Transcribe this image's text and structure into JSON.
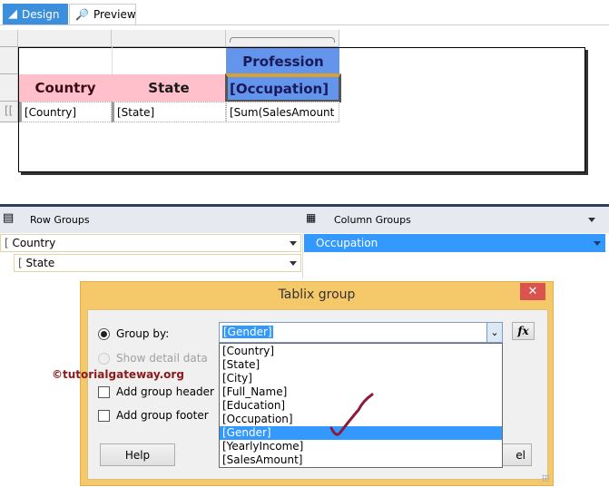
{
  "tabs": [
    {
      "label": "Design",
      "icon": "design-ruler-icon",
      "active": true
    },
    {
      "label": "Preview",
      "icon": "preview-icon",
      "active": false
    }
  ],
  "tablix": {
    "header_row1": {
      "profession": "Profession"
    },
    "header_row2": {
      "country": "Country",
      "state": "State",
      "occupation": "[Occupation]"
    },
    "data_row": {
      "country": "[Country]",
      "state": "[State]",
      "sum": "[Sum(SalesAmount"
    }
  },
  "groups": {
    "row_groups_label": "Row Groups",
    "column_groups_label": "Column Groups",
    "row_groups": [
      "Country",
      "State"
    ],
    "column_groups": [
      "Occupation"
    ]
  },
  "dialog": {
    "title": "Tablix group",
    "group_by_label": "Group by:",
    "group_by_value": "[Gender]",
    "show_detail_label": "Show detail data",
    "add_header_label": "Add group header",
    "add_footer_label": "Add group footer",
    "fx_label": "fx",
    "help_label": "Help",
    "cancel_partial": "el",
    "options": [
      "[Country]",
      "[State]",
      "[City]",
      "[Full_Name]",
      "[Education]",
      "[Occupation]",
      "[Gender]",
      "[YearlyIncome]",
      "[SalesAmount]"
    ],
    "selected_index": 6
  },
  "watermark": "©tutorialgateway.org",
  "colors": {
    "accent": "#3399ff",
    "header_blue": "#6495ed",
    "header_pink": "#ffc0cb",
    "dialog_border": "#f5c86a",
    "close_red": "#d9534f"
  }
}
